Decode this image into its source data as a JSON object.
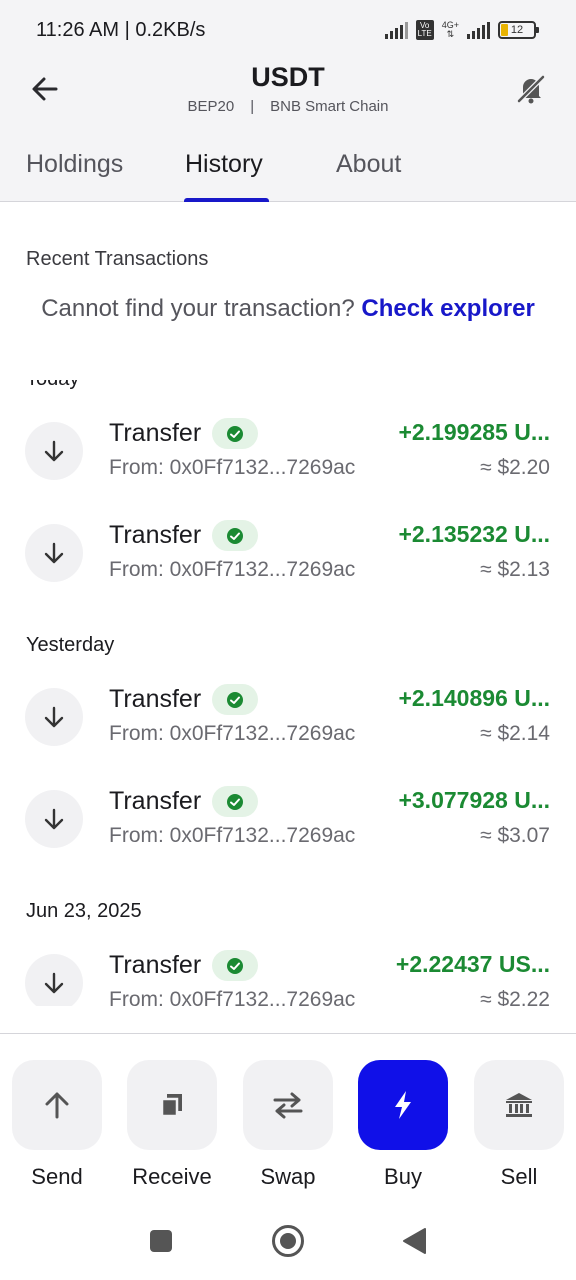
{
  "status_bar": {
    "time": "11:26 AM",
    "speed": "0.2KB/s",
    "volte": "Vo LTE",
    "network": "4G+",
    "battery": "12"
  },
  "header": {
    "title": "USDT",
    "network_tag": "BEP20",
    "separator": "|",
    "chain": "BNB Smart Chain"
  },
  "tabs": [
    {
      "label": "Holdings",
      "active": false
    },
    {
      "label": "History",
      "active": true
    },
    {
      "label": "About",
      "active": false
    }
  ],
  "content": {
    "section_title": "Recent Transactions",
    "explorer_prompt": "Cannot find your transaction?",
    "explorer_link": "Check explorer"
  },
  "groups": [
    {
      "label": "Today",
      "transactions": [
        {
          "type": "Transfer",
          "from": "From: 0x0Ff7132...7269ac",
          "amount": "+2.199285 U...",
          "usd": "≈ $2.20"
        },
        {
          "type": "Transfer",
          "from": "From: 0x0Ff7132...7269ac",
          "amount": "+2.135232 U...",
          "usd": "≈ $2.13"
        }
      ]
    },
    {
      "label": "Yesterday",
      "transactions": [
        {
          "type": "Transfer",
          "from": "From: 0x0Ff7132...7269ac",
          "amount": "+2.140896 U...",
          "usd": "≈ $2.14"
        },
        {
          "type": "Transfer",
          "from": "From: 0x0Ff7132...7269ac",
          "amount": "+3.077928 U...",
          "usd": "≈ $3.07"
        }
      ]
    },
    {
      "label": "Jun 23, 2025",
      "transactions": [
        {
          "type": "Transfer",
          "from": "From: 0x0Ff7132...7269ac",
          "amount": "+2.22437 US...",
          "usd": "≈ $2.22"
        }
      ]
    }
  ],
  "actions": [
    {
      "label": "Send",
      "icon": "arrow-up-icon"
    },
    {
      "label": "Receive",
      "icon": "copy-icon"
    },
    {
      "label": "Swap",
      "icon": "swap-icon"
    },
    {
      "label": "Buy",
      "icon": "lightning-icon"
    },
    {
      "label": "Sell",
      "icon": "bank-icon"
    }
  ],
  "colors": {
    "accent": "#1818c9",
    "buy_button": "#1010e8",
    "positive": "#1b8a33",
    "badge_bg": "#e4f3e6"
  }
}
